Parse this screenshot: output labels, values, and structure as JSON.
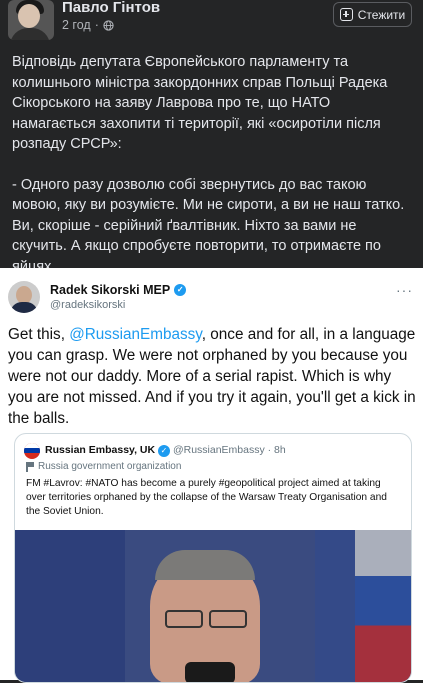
{
  "post": {
    "author": "Павло Гінтов",
    "time": "2 год",
    "follow_label": "Стежити",
    "paragraphs": [
      "Відповідь депутата Європейського парламенту та колишнього міністра закордонних справ Польщі Радека Сікорського на заяву Лаврова про те, що НАТО намагається захопити ті території, які «осиротіли після розпаду СРСР»:",
      "- Одного разу дозволю собі звернутись до вас такою мовою, яку ви розумієте. Ми не сироти, а ви не наш татко. Ви, скоріше - серійний ґвалтівник. Ніхто за вами не скучить. А якщо спробуєте повторити, то отримаєте по яйцях."
    ]
  },
  "tweet": {
    "name": "Radek Sikorski MEP",
    "handle": "@radeksikorski",
    "text_before": "Get this, ",
    "mention": "@RussianEmbassy",
    "text_after": ", once and for all, in a language you can grasp. We were not orphaned by you because you were not our daddy. More of a serial rapist. Which is why you are not missed. And if you try it again, you'll get a kick in the balls.",
    "quoted": {
      "name": "Russian Embassy, UK",
      "handle": "@RussianEmbassy · 8h",
      "org_label": "Russia government organization",
      "text": "FM #Lavrov: #NATO has become a purely #geopolitical project aimed at taking over territories orphaned by the collapse of the Warsaw Treaty Organisation and the Soviet Union."
    }
  },
  "colors": {
    "fb_bg": "#242526",
    "fb_text": "#e4e6eb",
    "twitter_blue": "#1d9bf0"
  }
}
